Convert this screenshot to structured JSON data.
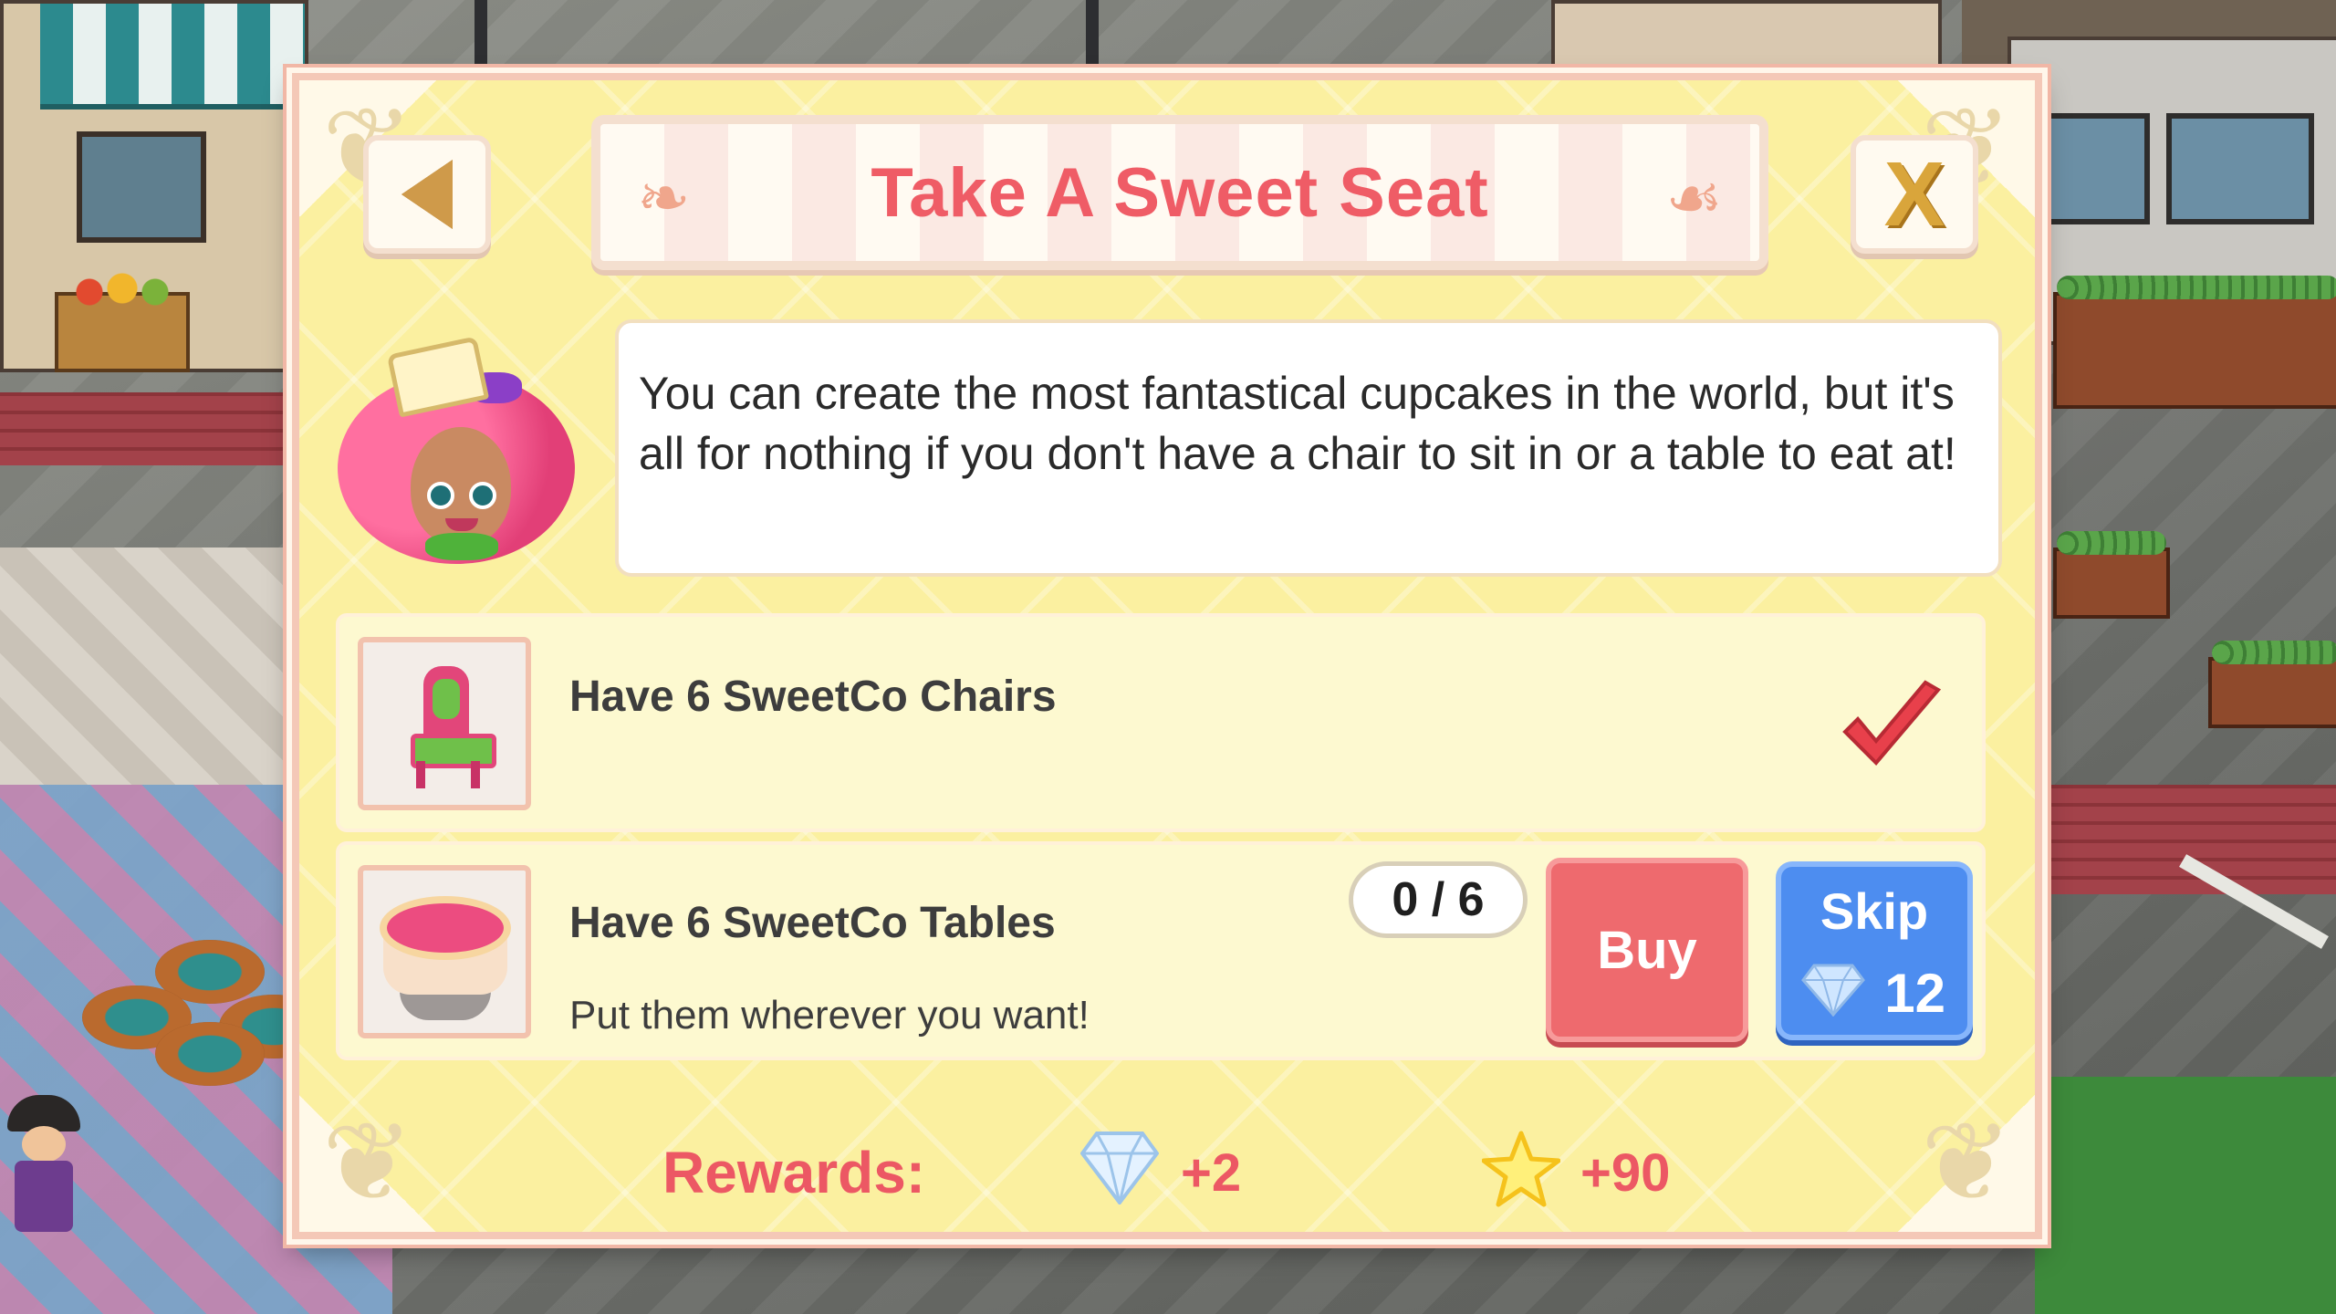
{
  "dialog": {
    "title": "Take A Sweet Seat",
    "back_icon": "left-arrow-icon",
    "close_icon": "close-x-icon",
    "close_glyph": "X",
    "speech": "You can create the most fantastical cupcakes in the world, but it's all for nothing if you don't have a chair to sit in or a table to eat at!"
  },
  "tasks": [
    {
      "title": "Have 6 SweetCo Chairs",
      "icon": "pink-chair-icon",
      "status_icon": "checkmark-icon",
      "completed": true
    },
    {
      "title": "Have 6 SweetCo Tables",
      "subtitle": "Put them wherever you want!",
      "icon": "pink-table-icon",
      "progress": "0 / 6",
      "buy_label": "Buy",
      "skip_label": "Skip",
      "skip_cost": "12",
      "skip_cost_icon": "diamond-icon",
      "completed": false
    }
  ],
  "rewards": {
    "label": "Rewards:",
    "gems": "+2",
    "gems_icon": "diamond-icon",
    "stars": "+90",
    "stars_icon": "star-icon"
  },
  "colors": {
    "title": "#ef5c66",
    "panel_bg": "#fbf0a0",
    "buy_button": "#ee6a6e",
    "skip_button": "#4d8df0",
    "rewards_text": "#ec5864",
    "checkmark": "#e8404b"
  }
}
